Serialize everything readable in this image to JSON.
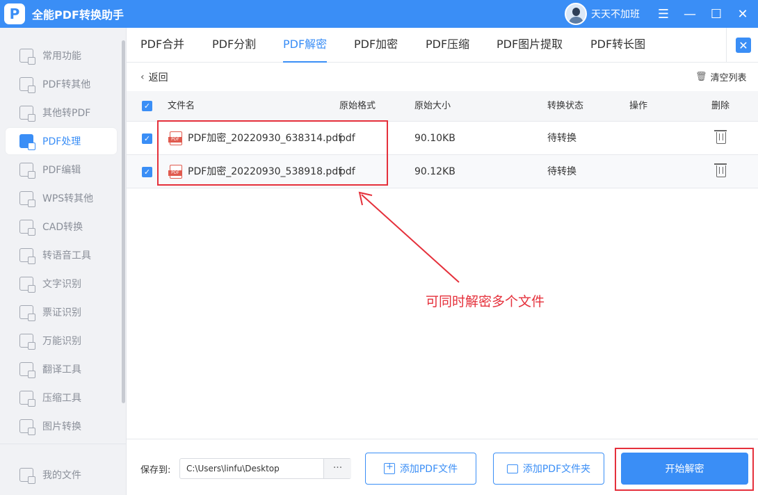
{
  "app": {
    "title": "全能PDF转换助手",
    "logo_letter": "P"
  },
  "user": {
    "name": "天天不加班"
  },
  "window_controls": {
    "menu": "☰",
    "minimize": "—",
    "maximize": "☐",
    "close": "✕"
  },
  "sidebar": {
    "items": [
      {
        "label": "常用功能",
        "icon": "common-functions-icon"
      },
      {
        "label": "PDF转其他",
        "icon": "pdf-to-other-icon"
      },
      {
        "label": "其他转PDF",
        "icon": "other-to-pdf-icon"
      },
      {
        "label": "PDF处理",
        "icon": "pdf-process-icon",
        "active": true
      },
      {
        "label": "PDF编辑",
        "icon": "pdf-edit-icon"
      },
      {
        "label": "WPS转其他",
        "icon": "wps-convert-icon"
      },
      {
        "label": "CAD转换",
        "icon": "cad-convert-icon"
      },
      {
        "label": "转语音工具",
        "icon": "text-to-speech-icon"
      },
      {
        "label": "文字识别",
        "icon": "text-recognition-icon"
      },
      {
        "label": "票证识别",
        "icon": "ticket-recognition-icon"
      },
      {
        "label": "万能识别",
        "icon": "universal-recognition-icon"
      },
      {
        "label": "翻译工具",
        "icon": "translate-icon"
      },
      {
        "label": "压缩工具",
        "icon": "compress-icon"
      },
      {
        "label": "图片转换",
        "icon": "image-convert-icon"
      }
    ],
    "my_files": "我的文件"
  },
  "tabs": [
    {
      "label": "PDF合并"
    },
    {
      "label": "PDF分割"
    },
    {
      "label": "PDF解密",
      "active": true
    },
    {
      "label": "PDF加密"
    },
    {
      "label": "PDF压缩"
    },
    {
      "label": "PDF图片提取"
    },
    {
      "label": "PDF转长图"
    }
  ],
  "toolbar": {
    "back_label": "返回",
    "clear_list_label": "清空列表"
  },
  "table": {
    "headers": {
      "filename": "文件名",
      "format": "原始格式",
      "size": "原始大小",
      "status": "转换状态",
      "action": "操作",
      "delete": "删除"
    },
    "rows": [
      {
        "filename": "PDF加密_20220930_638314.pdf",
        "format": "pdf",
        "size": "90.10KB",
        "status": "待转换"
      },
      {
        "filename": "PDF加密_20220930_538918.pdf",
        "format": "pdf",
        "size": "90.12KB",
        "status": "待转换"
      }
    ]
  },
  "annotation": {
    "text": "可同时解密多个文件",
    "color": "#e5303b"
  },
  "bottom": {
    "save_label": "保存到:",
    "save_path": "C:\\Users\\linfu\\Desktop",
    "browse_label": "···",
    "add_file_label": "添加PDF文件",
    "add_folder_label": "添加PDF文件夹",
    "start_label": "开始解密"
  },
  "colors": {
    "accent": "#3a8ef6",
    "annotation": "#e5303b",
    "sidebar_bg": "#f1f2f5"
  }
}
